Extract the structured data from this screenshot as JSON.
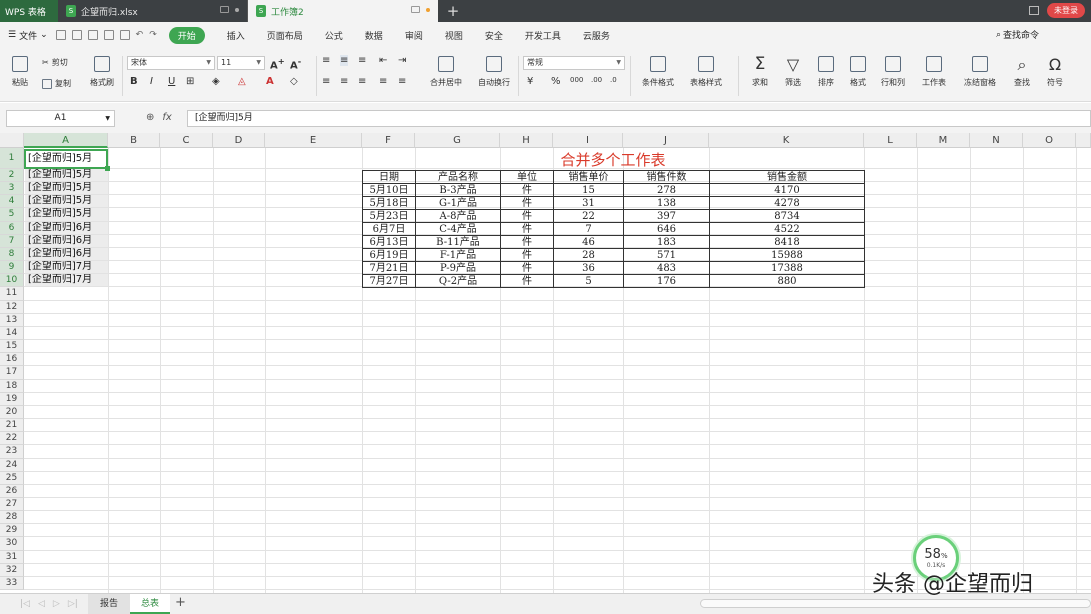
{
  "titlebar": {
    "app_name": "WPS 表格",
    "tabs": [
      {
        "label": "企望而归.xlsx",
        "active": false
      },
      {
        "label": "工作簿2",
        "active": true
      }
    ],
    "login_label": "未登录"
  },
  "menubar": {
    "file_label": "文件",
    "tabs": [
      "开始",
      "插入",
      "页面布局",
      "公式",
      "数据",
      "审阅",
      "视图",
      "安全",
      "开发工具",
      "云服务"
    ],
    "active_tab": "开始",
    "search_label": "查找命令"
  },
  "ribbon": {
    "paste": "粘贴",
    "cut": "剪切",
    "copy": "复制",
    "format_painter": "格式刷",
    "font_name": "宋体",
    "font_size": "11",
    "merge_center": "合并居中",
    "wrap_text": "自动换行",
    "number_format": "常规",
    "conditional_format": "条件格式",
    "table_style": "表格样式",
    "sum": "求和",
    "filter": "筛选",
    "sort": "排序",
    "format": "格式",
    "rows_cols": "行和列",
    "worksheet": "工作表",
    "freeze_panes": "冻结窗格",
    "find": "查找",
    "symbol": "符号"
  },
  "formula_bar": {
    "cell_ref": "A1",
    "fx_label": "fx",
    "value": "[企望而归]5月"
  },
  "columns": [
    "A",
    "B",
    "C",
    "D",
    "E",
    "F",
    "G",
    "H",
    "I",
    "J",
    "K",
    "L",
    "M",
    "N",
    "O"
  ],
  "rows": [
    "1",
    "2",
    "3",
    "4",
    "5",
    "6",
    "7",
    "8",
    "9",
    "10",
    "11",
    "12",
    "13",
    "14",
    "15",
    "16",
    "17",
    "18",
    "19",
    "20",
    "21",
    "22",
    "23",
    "24",
    "25",
    "26",
    "27",
    "28",
    "29",
    "30",
    "31",
    "32",
    "33"
  ],
  "column_a": [
    "[企望而归]5月",
    "[企望而归]5月",
    "[企望而归]5月",
    "[企望而归]5月",
    "[企望而归]5月",
    "[企望而归]6月",
    "[企望而归]6月",
    "[企望而归]6月",
    "[企望而归]7月",
    "[企望而归]7月"
  ],
  "table": {
    "title": "合并多个工作表",
    "headers": [
      "日期",
      "产品名称",
      "单位",
      "销售单价",
      "销售件数",
      "销售金额"
    ],
    "rows": [
      [
        "5月10日",
        "B-3产品",
        "件",
        "15",
        "278",
        "4170"
      ],
      [
        "5月18日",
        "G-1产品",
        "件",
        "31",
        "138",
        "4278"
      ],
      [
        "5月23日",
        "A-8产品",
        "件",
        "22",
        "397",
        "8734"
      ],
      [
        "6月7日",
        "C-4产品",
        "件",
        "7",
        "646",
        "4522"
      ],
      [
        "6月13日",
        "B-11产品",
        "件",
        "46",
        "183",
        "8418"
      ],
      [
        "6月19日",
        "F-1产品",
        "件",
        "28",
        "571",
        "15988"
      ],
      [
        "7月21日",
        "P-9产品",
        "件",
        "36",
        "483",
        "17388"
      ],
      [
        "7月27日",
        "Q-2产品",
        "件",
        "5",
        "176",
        "880"
      ]
    ]
  },
  "sheet_tabs": [
    {
      "label": "报告",
      "active": false
    },
    {
      "label": "总表",
      "active": true
    }
  ],
  "speed_widget": {
    "percent": "58",
    "unit": "%",
    "rate": "0.1K/s"
  },
  "watermark": "头条 @企望而归",
  "colors": {
    "accent": "#3ea652",
    "title_red": "#d93a2a",
    "titlebar": "#3c4043"
  }
}
